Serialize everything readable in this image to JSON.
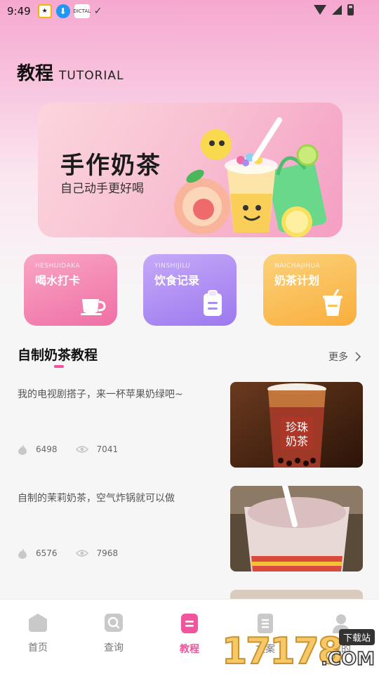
{
  "status_bar": {
    "time": "9:49",
    "app3_label": "DICTAL",
    "check": "✓"
  },
  "header": {
    "title_cn": "教程",
    "title_en": "TUTORIAL"
  },
  "banner": {
    "title": "手作奶茶",
    "subtitle": "自己动手更好喝"
  },
  "quick_cards": [
    {
      "en": "HESHUIDAKA",
      "cn": "喝水打卡",
      "icon": "cup-icon"
    },
    {
      "en": "YINSHIJILU",
      "cn": "饮食记录",
      "icon": "clipboard-icon"
    },
    {
      "en": "NAICHAJIHUA",
      "cn": "奶茶计划",
      "icon": "drink-cup-icon"
    }
  ],
  "section": {
    "title": "自制奶茶教程",
    "more": "更多"
  },
  "posts": [
    {
      "title": "我的电视剧搭子，来一杯苹果奶绿吧~",
      "likes": "6498",
      "views": "7041",
      "image_text": "珍珠\n奶茶"
    },
    {
      "title": "自制的茉莉奶茶，空气炸锅就可以做",
      "likes": "6576",
      "views": "7968"
    }
  ],
  "tabs": [
    {
      "label": "首页",
      "icon": "home-icon"
    },
    {
      "label": "查询",
      "icon": "search-icon"
    },
    {
      "label": "教程",
      "icon": "document-icon",
      "active": true
    },
    {
      "label": "文案",
      "icon": "notes-icon"
    },
    {
      "label": "我的",
      "icon": "person-icon"
    }
  ],
  "watermark": {
    "number": "17178",
    "tag": "下载站",
    "domain": ".COM"
  },
  "colors": {
    "accent": "#f2549e",
    "card_pink": "#ef6fa5",
    "card_purple": "#9c79ef",
    "card_orange": "#f9ae3d"
  }
}
